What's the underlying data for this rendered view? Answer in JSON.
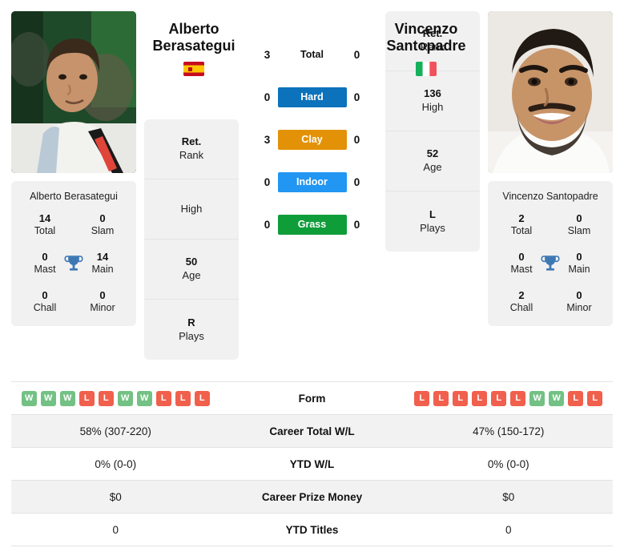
{
  "players": {
    "left": {
      "first_name": "Alberto",
      "last_name": "Berasategui",
      "flag": "spain-flag",
      "photo": "player-photo-berasategui",
      "full_name": "Alberto Berasategui",
      "titles": {
        "total": "14",
        "total_label": "Total",
        "slam": "0",
        "slam_label": "Slam",
        "mast": "0",
        "mast_label": "Mast",
        "main": "14",
        "main_label": "Main",
        "chall": "0",
        "chall_label": "Chall",
        "minor": "0",
        "minor_label": "Minor"
      },
      "info": {
        "rank_value": "Ret.",
        "rank_label": "Rank",
        "high_value": "",
        "high_label": "High",
        "age_value": "50",
        "age_label": "Age",
        "plays_value": "R",
        "plays_label": "Plays"
      },
      "form": [
        "W",
        "W",
        "W",
        "L",
        "L",
        "W",
        "W",
        "L",
        "L",
        "L"
      ],
      "career_wl": "58% (307-220)",
      "ytd_wl": "0% (0-0)",
      "prize_money": "$0",
      "ytd_titles": "0"
    },
    "right": {
      "first_name": "Vincenzo",
      "last_name": "Santopadre",
      "flag": "italy-flag",
      "photo": "player-photo-santopadre",
      "full_name": "Vincenzo Santopadre",
      "titles": {
        "total": "2",
        "total_label": "Total",
        "slam": "0",
        "slam_label": "Slam",
        "mast": "0",
        "mast_label": "Mast",
        "main": "0",
        "main_label": "Main",
        "chall": "2",
        "chall_label": "Chall",
        "minor": "0",
        "minor_label": "Minor"
      },
      "info": {
        "rank_value": "Ret.",
        "rank_label": "Rank",
        "high_value": "136",
        "high_label": "High",
        "age_value": "52",
        "age_label": "Age",
        "plays_value": "L",
        "plays_label": "Plays"
      },
      "form": [
        "L",
        "L",
        "L",
        "L",
        "L",
        "L",
        "W",
        "W",
        "L",
        "L"
      ],
      "career_wl": "47% (150-172)",
      "ytd_wl": "0% (0-0)",
      "prize_money": "$0",
      "ytd_titles": "0"
    }
  },
  "head_to_head": [
    {
      "label": "Total",
      "left": "3",
      "right": "0",
      "color": "",
      "style": "plain"
    },
    {
      "label": "Hard",
      "left": "0",
      "right": "0",
      "color": "#0b72bb",
      "style": "badge"
    },
    {
      "label": "Clay",
      "left": "3",
      "right": "0",
      "color": "#e39208",
      "style": "badge"
    },
    {
      "label": "Indoor",
      "left": "0",
      "right": "0",
      "color": "#2196f3",
      "style": "badge"
    },
    {
      "label": "Grass",
      "left": "0",
      "right": "0",
      "color": "#0f9d3a",
      "style": "badge"
    }
  ],
  "comparison_rows": [
    {
      "label": "Form",
      "left": "",
      "right": "",
      "type": "form"
    },
    {
      "label": "Career Total W/L",
      "left": "58% (307-220)",
      "right": "47% (150-172)",
      "type": "text"
    },
    {
      "label": "YTD W/L",
      "left": "0% (0-0)",
      "right": "0% (0-0)",
      "type": "text"
    },
    {
      "label": "Career Prize Money",
      "left": "$0",
      "right": "$0",
      "type": "text"
    },
    {
      "label": "YTD Titles",
      "left": "0",
      "right": "0",
      "type": "text"
    }
  ],
  "colors": {
    "hard": "#0b72bb",
    "clay": "#e39208",
    "indoor": "#2196f3",
    "grass": "#0f9d3a",
    "win": "#73c184",
    "loss": "#f0604d",
    "card": "#f1f1f2",
    "trophy": "#3e78b2"
  }
}
